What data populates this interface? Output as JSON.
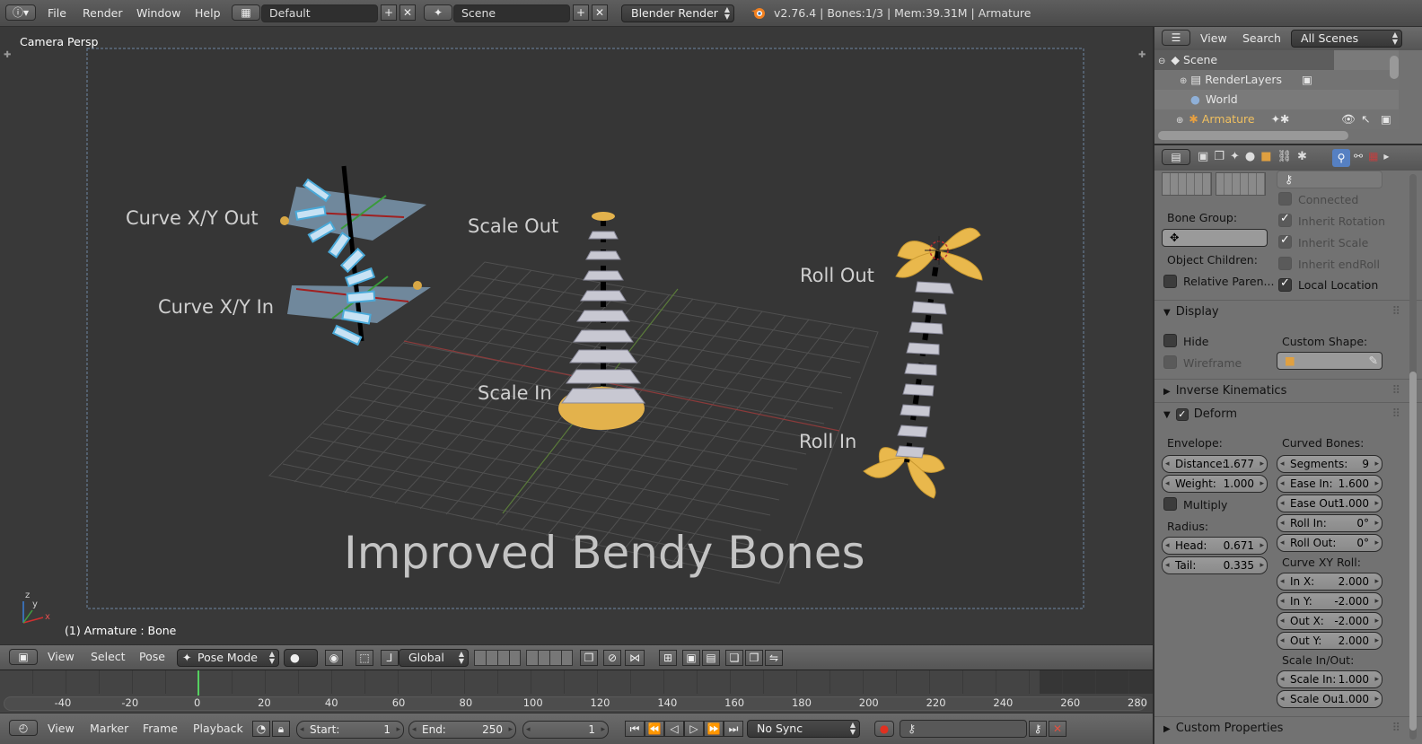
{
  "topbar": {
    "menus": [
      "File",
      "Render",
      "Window",
      "Help"
    ],
    "layout": "Default",
    "scene": "Scene",
    "engine": "Blender Render",
    "status": "v2.76.4 | Bones:1/3 | Mem:39.31M | Armature"
  },
  "viewport": {
    "title": "Camera Persp",
    "footer": "(1) Armature : Bone",
    "caption": "Improved Bendy Bones",
    "labels": {
      "curve_out": "Curve X/Y Out",
      "curve_in": "Curve X/Y In",
      "scale_out": "Scale Out",
      "scale_in": "Scale In",
      "roll_out": "Roll Out",
      "roll_in": "Roll In"
    },
    "axis": {
      "z": "z",
      "y": "y",
      "x": "x"
    }
  },
  "header3d": {
    "menus": [
      "View",
      "Select",
      "Pose"
    ],
    "mode": "Pose Mode",
    "orientation": "Global"
  },
  "timeline": {
    "ticks": [
      "-40",
      "-20",
      "0",
      "20",
      "40",
      "60",
      "80",
      "100",
      "120",
      "140",
      "160",
      "180",
      "200",
      "220",
      "240",
      "260",
      "280"
    ]
  },
  "timeline_header": {
    "menus": [
      "View",
      "Marker",
      "Frame",
      "Playback"
    ],
    "start_label": "Start:",
    "start": "1",
    "end_label": "End:",
    "end": "250",
    "current": "1",
    "sync": "No Sync"
  },
  "outliner": {
    "menus": [
      "View",
      "Search"
    ],
    "filter": "All Scenes",
    "items": [
      "Scene",
      "RenderLayers",
      "World",
      "Armature"
    ]
  },
  "properties": {
    "connected": "Connected",
    "inherit_rotation": "Inherit Rotation",
    "inherit_scale": "Inherit Scale",
    "inherit_endroll": "Inherit endRoll",
    "local_location": "Local Location",
    "bone_group": "Bone Group:",
    "object_children": "Object Children:",
    "relative_parent": "Relative Paren...",
    "display": {
      "title": "Display",
      "hide": "Hide",
      "wireframe": "Wireframe",
      "custom_shape": "Custom Shape:"
    },
    "ik_title": "Inverse Kinematics",
    "deform": {
      "title": "Deform",
      "envelope": "Envelope:",
      "distance_label": "Distance:",
      "distance": "1.677",
      "weight_label": "Weight:",
      "weight": "1.000",
      "multiply": "Multiply",
      "radius": "Radius:",
      "head_label": "Head:",
      "head": "0.671",
      "tail_label": "Tail:",
      "tail": "0.335",
      "curved_bones": "Curved Bones:",
      "segments_label": "Segments:",
      "segments": "9",
      "easein_label": "Ease In:",
      "easein": "1.600",
      "easeout_label": "Ease Out:",
      "easeout": "1.000",
      "rollin_label": "Roll In:",
      "rollin": "0°",
      "rollout_label": "Roll Out:",
      "rollout": "0°",
      "curvexy": "Curve XY Roll:",
      "inx_label": "In X:",
      "inx": "2.000",
      "iny_label": "In Y:",
      "iny": "-2.000",
      "outx_label": "Out X:",
      "outx": "-2.000",
      "outy_label": "Out Y:",
      "outy": "2.000",
      "scaleinout": "Scale In/Out:",
      "scalein_label": "Scale In:",
      "scalein": "1.000",
      "scaleout_label": "Scale Ou:",
      "scaleout": "1.000"
    },
    "custom_props": "Custom Properties"
  },
  "colors": {
    "accent": "#e8b64c",
    "active_blue": "#5680c2",
    "viewport_bg": "#393939"
  }
}
